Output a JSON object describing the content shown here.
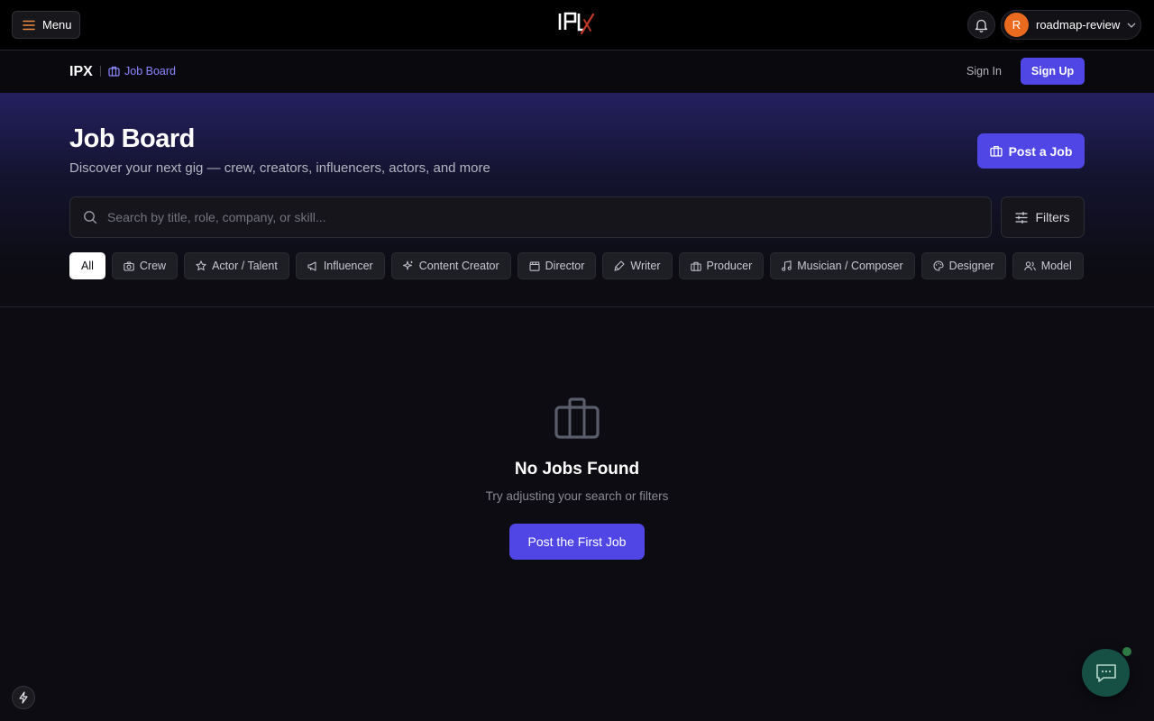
{
  "topbar": {
    "menu_label": "Menu",
    "logo_alt": "IPX",
    "user": {
      "initial": "R",
      "name": "roadmap-review"
    }
  },
  "nav": {
    "brand": "IPX",
    "breadcrumb": "Job Board",
    "sign_in": "Sign In",
    "sign_up": "Sign Up"
  },
  "hero": {
    "title": "Job Board",
    "subtitle": "Discover your next gig — crew, creators, influencers, actors, and more",
    "post_job": "Post a Job",
    "search_placeholder": "Search by title, role, company, or skill...",
    "filters": "Filters"
  },
  "categories": [
    {
      "label": "All",
      "icon": "none",
      "active": true
    },
    {
      "label": "Crew",
      "icon": "camera-icon",
      "active": false
    },
    {
      "label": "Actor / Talent",
      "icon": "star-icon",
      "active": false
    },
    {
      "label": "Influencer",
      "icon": "megaphone-icon",
      "active": false
    },
    {
      "label": "Content Creator",
      "icon": "sparkles-icon",
      "active": false
    },
    {
      "label": "Director",
      "icon": "clapperboard-icon",
      "active": false
    },
    {
      "label": "Writer",
      "icon": "pen-icon",
      "active": false
    },
    {
      "label": "Producer",
      "icon": "briefcase-icon",
      "active": false
    },
    {
      "label": "Musician / Composer",
      "icon": "music-icon",
      "active": false
    },
    {
      "label": "Designer",
      "icon": "palette-icon",
      "active": false
    },
    {
      "label": "Model",
      "icon": "users-icon",
      "active": false
    },
    {
      "label": "",
      "icon": "none",
      "active": false
    }
  ],
  "empty_state": {
    "icon": "briefcase-icon",
    "title": "No Jobs Found",
    "subtitle": "Try adjusting your search or filters",
    "cta": "Post the First Job"
  },
  "colors": {
    "accent": "#5046e5",
    "link": "#8b87ff",
    "avatar": "#ea6a1f",
    "chat": "#165044"
  }
}
